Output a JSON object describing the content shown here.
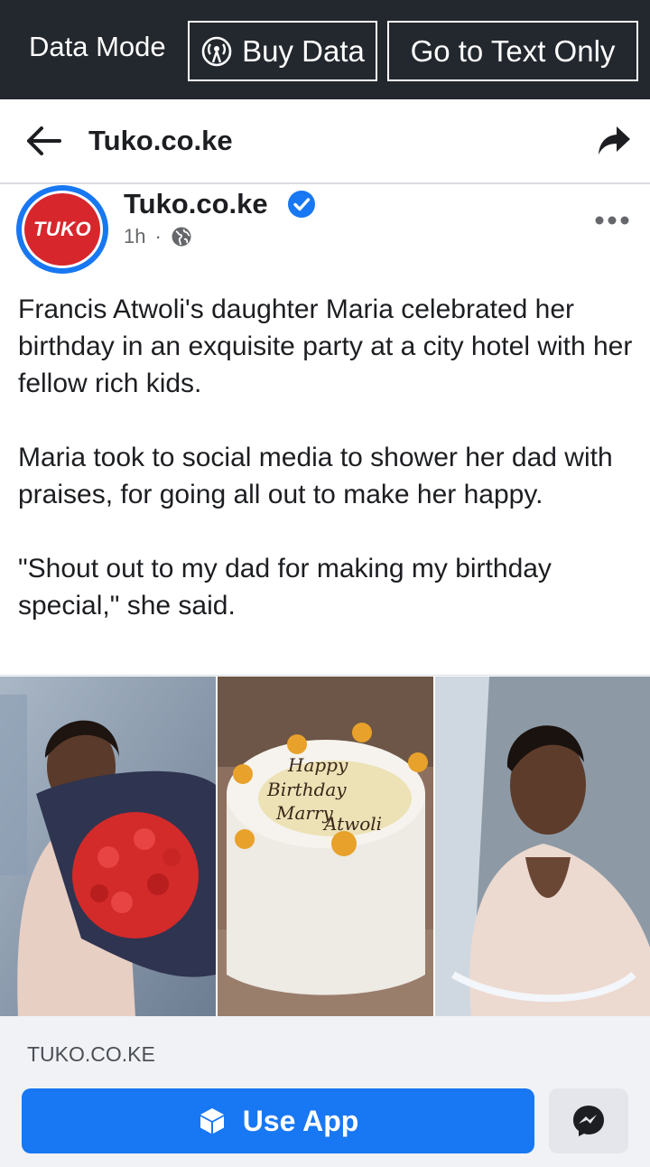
{
  "databar": {
    "mode_label": "Data Mode",
    "buy_data_label": "Buy Data",
    "text_only_label": "Go to Text Only"
  },
  "header": {
    "title": "Tuko.co.ke"
  },
  "post": {
    "avatar_logo_text": "TUKO",
    "author": "Tuko.co.ke",
    "time": "1h",
    "separator": "·",
    "paragraphs": [
      "Francis Atwoli's daughter Maria celebrated her birthday in an exquisite party at a city hotel with her fellow rich kids.",
      "Maria took to social media to shower her dad with praises, for going all out to make her happy.",
      "\"Shout out to my dad for making my birthday special,\" she said."
    ],
    "cake_text": [
      "Happy",
      "Birthday",
      "Marry",
      "Atwoli"
    ]
  },
  "link_preview": {
    "domain": "TUKO.CO.KE"
  },
  "actions": {
    "use_app_label": "Use App"
  },
  "colors": {
    "databar_bg": "#23282e",
    "brand_blue": "#1877f2",
    "tuko_red": "#d8262d",
    "footer_bg": "#f0f2f5"
  }
}
